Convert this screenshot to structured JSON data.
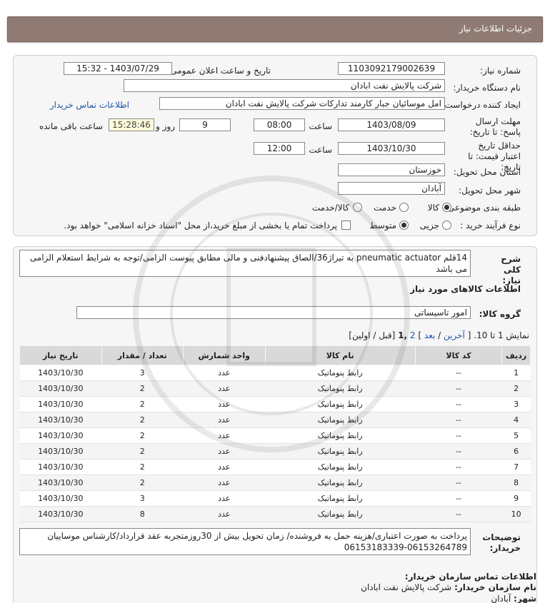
{
  "page_title": "جزئیات اطلاعات نیاز",
  "need_number": {
    "label": "شماره نیاز:",
    "value": "1103092179002639"
  },
  "announce_datetime": {
    "label": "تاریخ و ساعت اعلان عمومی:",
    "value": "1403/07/29 - 15:32"
  },
  "buyer_org": {
    "label": "نام دستگاه خریدار:",
    "value": "شرکت پالایش نفت ابادان"
  },
  "creator": {
    "label": "ایجاد کننده درخواست:",
    "value": "امل موسائیان جبار کارمند تدارکات شرکت پالایش نفت ابادان",
    "contact_link": "اطلاعات تماس خریدار"
  },
  "reply_deadline": {
    "label": "مهلت ارسال پاسخ: تا تاریخ:",
    "date": "1403/08/09",
    "time_label": "ساعت",
    "time": "08:00",
    "days": "9",
    "days_label": "روز و",
    "remaining": "15:28:46",
    "remaining_label": "ساعت باقی مانده"
  },
  "price_validity": {
    "label": "حداقل تاریخ اعتبار قیمت: تا تاریخ:",
    "date": "1403/10/30",
    "time_label": "ساعت",
    "time": "12:00"
  },
  "delivery_province": {
    "label": "استان محل تحویل:",
    "value": "خوزستان"
  },
  "delivery_city": {
    "label": "شهر محل تحویل:",
    "value": "آبادان"
  },
  "category": {
    "label": "طبقه بندی موضوعی:",
    "options": [
      "کالا",
      "خدمت",
      "کالا/خدمت"
    ],
    "selected": "کالا"
  },
  "purchase_process": {
    "label": "نوع فرآیند خرید :",
    "options": [
      "جزیی",
      "متوسط"
    ],
    "selected": "متوسط",
    "check_note": "پرداخت تمام یا بخشی از مبلغ خرید،از محل \"اسناد خزانه اسلامی\" خواهد بود."
  },
  "general_desc": {
    "label": "شرح کلی نیاز:",
    "value": "14قلم pneumatic actuator به تیراژ36/الصاق پیشنهادفنی و مالی مطابق پیوست الزامی/توجه به شرایط استعلام الزامی می باشد"
  },
  "goods_section_title": "اطلاعات کالاهای مورد نیاز",
  "goods_group": {
    "label": "گروه کالا:",
    "value": "امور تاسیساتی"
  },
  "pagination": {
    "text": "نمایش 1 تا 10.",
    "open": "[",
    "last": "آخرین",
    "sep1": "/",
    "next": "بعد",
    "close1": "]",
    "page2": "2",
    "page1": ",1",
    "prev_first": "[قبل / اولین]"
  },
  "table": {
    "headers": [
      "ردیف",
      "کد کالا",
      "نام کالا",
      "واحد شمارش",
      "تعداد / مقدار",
      "تاریخ نیاز"
    ],
    "rows": [
      [
        "1",
        "--",
        "رابط پنوماتیک",
        "عدد",
        "3",
        "1403/10/30"
      ],
      [
        "2",
        "--",
        "رابط پنوماتیک",
        "عدد",
        "2",
        "1403/10/30"
      ],
      [
        "3",
        "--",
        "رابط پنوماتیک",
        "عدد",
        "2",
        "1403/10/30"
      ],
      [
        "4",
        "--",
        "رابط پنوماتیک",
        "عدد",
        "2",
        "1403/10/30"
      ],
      [
        "5",
        "--",
        "رابط پنوماتیک",
        "عدد",
        "2",
        "1403/10/30"
      ],
      [
        "6",
        "--",
        "رابط پنوماتیک",
        "عدد",
        "2",
        "1403/10/30"
      ],
      [
        "7",
        "--",
        "رابط پنوماتیک",
        "عدد",
        "2",
        "1403/10/30"
      ],
      [
        "8",
        "--",
        "رابط پنوماتیک",
        "عدد",
        "2",
        "1403/10/30"
      ],
      [
        "9",
        "--",
        "رابط پنوماتیک",
        "عدد",
        "3",
        "1403/10/30"
      ],
      [
        "10",
        "--",
        "رابط پنوماتیک",
        "عدد",
        "8",
        "1403/10/30"
      ]
    ]
  },
  "buyer_notes": {
    "label": "توضیحات خریدار:",
    "value": "پرداخت به صورت اعتباری/هزینه حمل به فروشنده/ زمان تحویل بیش از 30روزمتجربه عقد قرارداد/کارشناس موساییان 06153264789-06153183339"
  },
  "buyer_contact": {
    "title": "اطلاعات تماس سازمان خریدار:",
    "org_label": "نام سازمان خریدار:",
    "org_value": "شرکت پالایش نفت ابادان",
    "city_label": "شهر:",
    "city_value": "آبادان"
  },
  "colors": {
    "titlebar": "#8f7b73",
    "panel": "#f6f6f6",
    "link": "#2056a8",
    "table_header": "#d9d9d9"
  }
}
